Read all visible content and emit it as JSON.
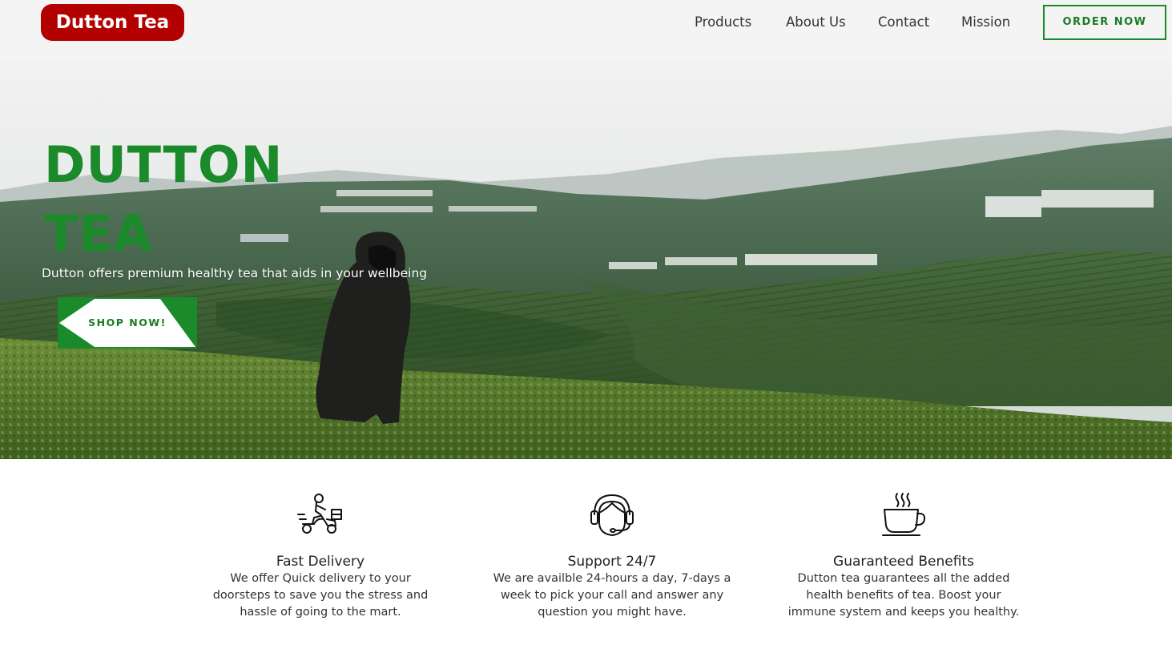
{
  "brand": {
    "name": "Dutton Tea"
  },
  "nav": {
    "links": [
      "Products",
      "About Us",
      "Contact",
      "Mission"
    ],
    "order_button": "ORDER NOW"
  },
  "hero": {
    "title_line1": "DUTTON",
    "title_line2": "TEA",
    "subtitle": "Dutton offers premium healthy tea that aids in your wellbeing",
    "cta": "SHOP NOW!"
  },
  "features": [
    {
      "icon": "delivery-scooter-icon",
      "title": "Fast Delivery",
      "text": "We offer Quick delivery to your doorsteps to save you the stress and hassle of going to the mart."
    },
    {
      "icon": "headset-support-icon",
      "title": "Support 24/7",
      "text": "We are availble 24-hours a day, 7-days a week to pick your call and answer any question you might have."
    },
    {
      "icon": "tea-cup-icon",
      "title": "Guaranteed Benefits",
      "text": "Dutton tea guarantees all the added health benefits of tea. Boost your immune system and keeps you healthy."
    }
  ],
  "colors": {
    "brand_red": "#b30000",
    "accent_green": "#1a8a2a",
    "nav_bg": "#f4f4f4"
  }
}
